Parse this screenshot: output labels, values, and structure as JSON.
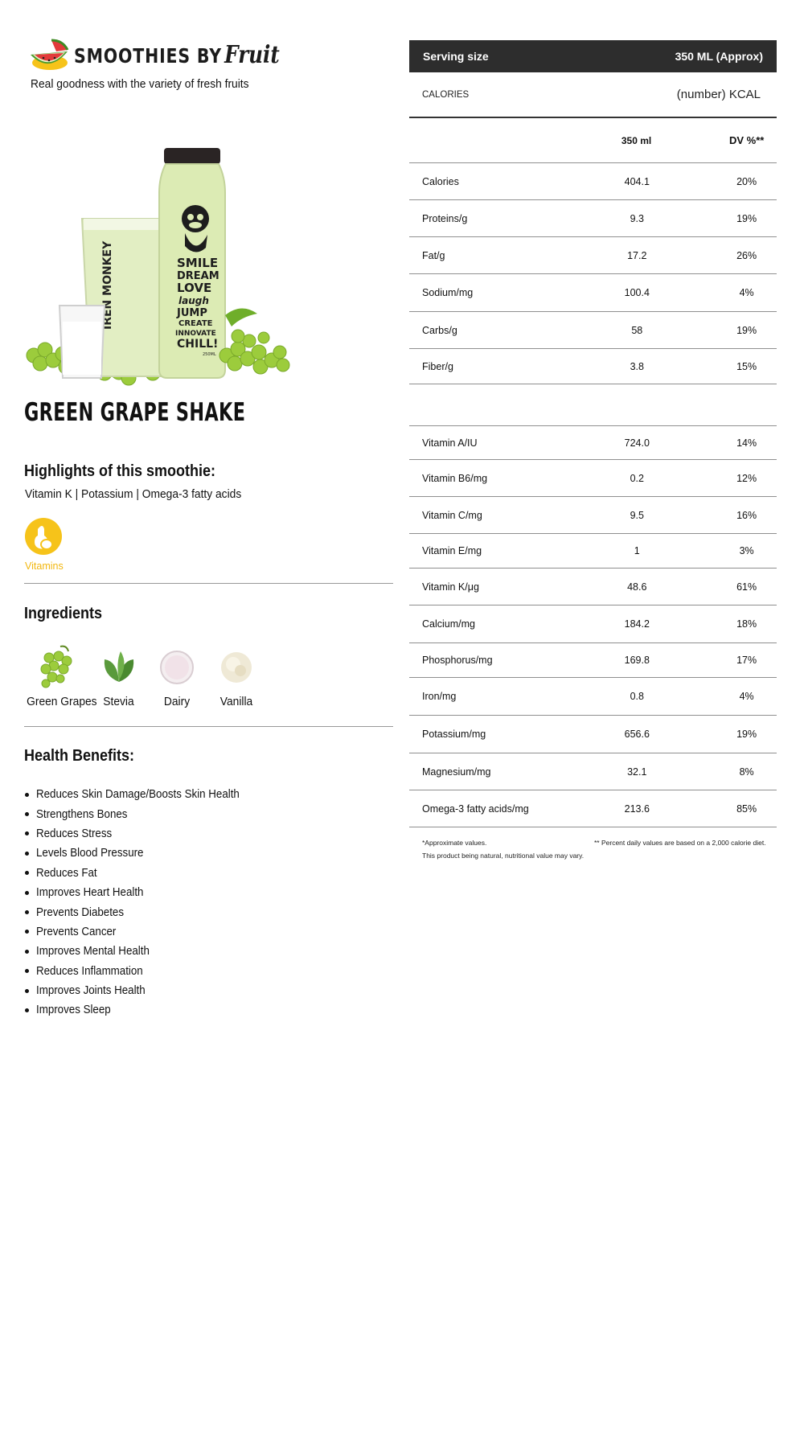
{
  "brand": {
    "name": "SMOOTHIES BY",
    "script": "Fruit",
    "tagline": "Real goodness with the variety of fresh fruits"
  },
  "product": {
    "title": "GREEN GRAPE SHAKE",
    "bottle_brand": "IREN MONKEY",
    "bottle_words": [
      "SMILE",
      "DREAM",
      "LOVE",
      "laugh",
      "JUMP",
      "CREATE",
      "INNOVATE",
      "CHILL!"
    ],
    "bottle_volume": "250ML"
  },
  "highlights": {
    "heading": "Highlights of this smoothie:",
    "text": "Vitamin K | Potassium | Omega-3 fatty acids",
    "badge_label": "Vitamins",
    "badge_icon": "vitamins-icon",
    "badge_color": "#f6c31a"
  },
  "ingredients": {
    "heading": "Ingredients",
    "items": [
      {
        "label": "Green Grapes",
        "icon": "green-grapes-icon"
      },
      {
        "label": "Stevia",
        "icon": "stevia-leaf-icon"
      },
      {
        "label": "Dairy",
        "icon": "dairy-icon"
      },
      {
        "label": "Vanilla",
        "icon": "vanilla-icon"
      }
    ]
  },
  "benefits": {
    "heading": "Health Benefits:",
    "items": [
      "Reduces Skin Damage/Boosts Skin Health",
      "Strengthens Bones",
      "Reduces Stress",
      "Levels Blood Pressure",
      "Reduces Fat",
      "Improves Heart Health",
      "Prevents Diabetes",
      "Prevents Cancer",
      "Improves Mental Health",
      "Reduces Inflammation",
      "Improves Joints Health",
      "Improves Sleep"
    ]
  },
  "nutrition": {
    "serving_label": "Serving size",
    "serving_value": "350 ML (Approx)",
    "calories_label": "CALORIES",
    "calories_value": "(number) KCAL",
    "col_amount": "350 ml",
    "col_dv": "DV %**",
    "macros": [
      {
        "name": "Calories",
        "amount": "404.1",
        "dv": "20%"
      },
      {
        "name": "Proteins/g",
        "amount": "9.3",
        "dv": "19%"
      },
      {
        "name": "Fat/g",
        "amount": "17.2",
        "dv": "26%"
      },
      {
        "name": "Sodium/mg",
        "amount": "100.4",
        "dv": "4%"
      },
      {
        "name": "Carbs/g",
        "amount": "58",
        "dv": "19%"
      },
      {
        "name": "Fiber/g",
        "amount": "3.8",
        "dv": "15%"
      }
    ],
    "micros": [
      {
        "name": "Vitamin A/IU",
        "amount": "724.0",
        "dv": "14%"
      },
      {
        "name": "Vitamin B6/mg",
        "amount": "0.2",
        "dv": "12%"
      },
      {
        "name": "Vitamin C/mg",
        "amount": "9.5",
        "dv": "16%"
      },
      {
        "name": "Vitamin E/mg",
        "amount": "1",
        "dv": "3%"
      },
      {
        "name": "Vitamin K/μg",
        "amount": "48.6",
        "dv": "61%"
      },
      {
        "name": "Calcium/mg",
        "amount": "184.2",
        "dv": "18%"
      },
      {
        "name": "Phosphorus/mg",
        "amount": "169.8",
        "dv": "17%"
      },
      {
        "name": "Iron/mg",
        "amount": "0.8",
        "dv": "4%"
      },
      {
        "name": "Potassium/mg",
        "amount": "656.6",
        "dv": "19%"
      },
      {
        "name": "Magnesium/mg",
        "amount": "32.1",
        "dv": "8%"
      },
      {
        "name": "Omega-3 fatty acids/mg",
        "amount": "213.6",
        "dv": "85%"
      }
    ],
    "footnote_approx": "*Approximate values.",
    "footnote_natural": "This product being natural, nutritional value may vary.",
    "footnote_dv": "** Percent daily values are based on a 2,000 calorie diet."
  },
  "colors": {
    "header_bg": "#2d2d2d",
    "accent_yellow": "#f6c31a",
    "grape_green": "#9ccc3c",
    "shake_green": "#dcebb4"
  }
}
